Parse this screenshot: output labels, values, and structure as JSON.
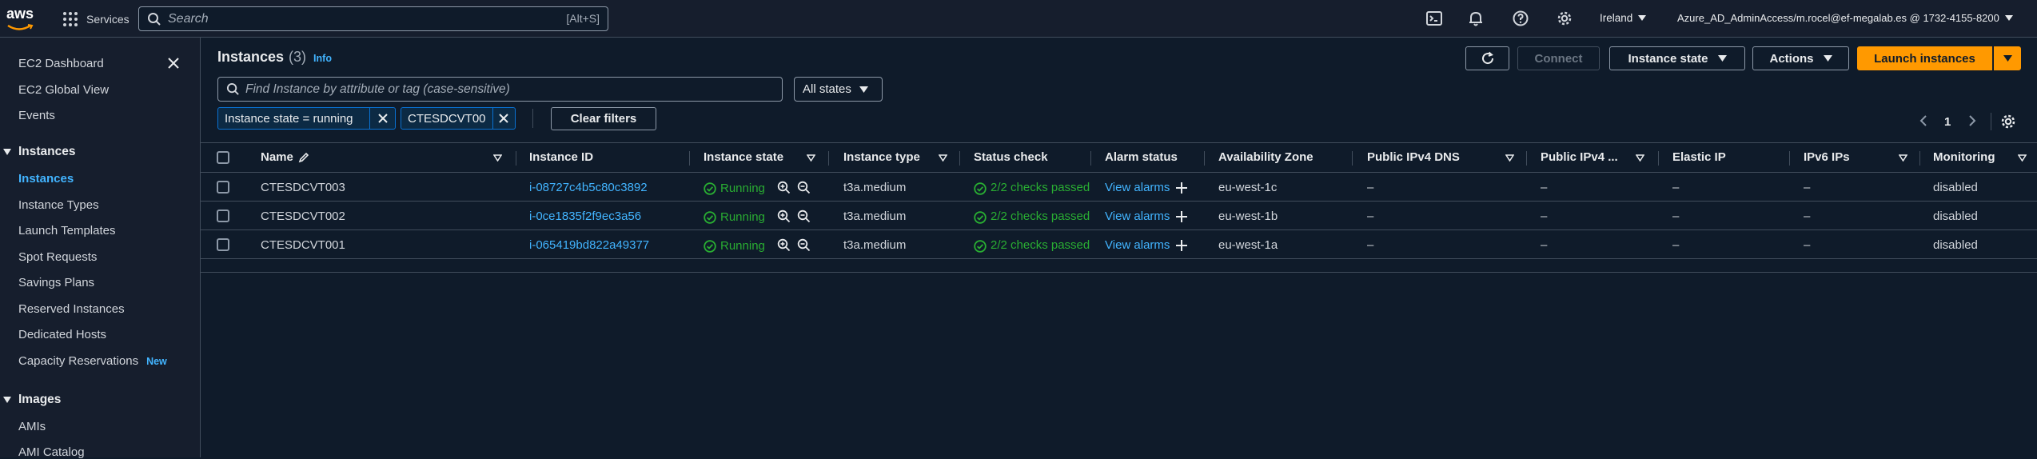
{
  "topnav": {
    "logo": "aws",
    "services_label": "Services",
    "search_placeholder": "Search",
    "search_shortcut": "[Alt+S]",
    "region": "Ireland",
    "account": "Azure_AD_AdminAccess/m.rocel@ef-megalab.es @ 1732-4155-8200"
  },
  "sidebar": {
    "items": [
      {
        "label": "EC2 Dashboard"
      },
      {
        "label": "EC2 Global View"
      },
      {
        "label": "Events"
      }
    ],
    "instances_section": "Instances",
    "instances_items": [
      {
        "label": "Instances"
      },
      {
        "label": "Instance Types"
      },
      {
        "label": "Launch Templates"
      },
      {
        "label": "Spot Requests"
      },
      {
        "label": "Savings Plans"
      },
      {
        "label": "Reserved Instances"
      },
      {
        "label": "Dedicated Hosts"
      },
      {
        "label": "Capacity Reservations"
      }
    ],
    "new_badge": "New",
    "images_section": "Images",
    "images_items": [
      {
        "label": "AMIs"
      },
      {
        "label": "AMI Catalog"
      }
    ]
  },
  "header": {
    "title": "Instances",
    "count": "(3)",
    "info": "Info",
    "connect": "Connect",
    "instance_state": "Instance state",
    "actions": "Actions",
    "launch": "Launch instances"
  },
  "filter": {
    "placeholder": "Find Instance by attribute or tag (case-sensitive)",
    "states_select": "All states",
    "chips": [
      "Instance state = running",
      "CTESDCVT00"
    ],
    "clear": "Clear filters",
    "page": "1"
  },
  "table": {
    "columns": [
      "Name",
      "Instance ID",
      "Instance state",
      "Instance type",
      "Status check",
      "Alarm status",
      "Availability Zone",
      "Public IPv4 DNS",
      "Public IPv4 ...",
      "Elastic IP",
      "IPv6 IPs",
      "Monitoring"
    ],
    "rows": [
      {
        "name": "CTESDCVT003",
        "id": "i-08727c4b5c80c3892",
        "state": "Running",
        "type": "t3a.medium",
        "status": "2/2 checks passed",
        "alarm": "View alarms",
        "az": "eu-west-1c",
        "dns": "–",
        "ipv4": "–",
        "eip": "–",
        "ipv6": "–",
        "monitoring": "disabled"
      },
      {
        "name": "CTESDCVT002",
        "id": "i-0ce1835f2f9ec3a56",
        "state": "Running",
        "type": "t3a.medium",
        "status": "2/2 checks passed",
        "alarm": "View alarms",
        "az": "eu-west-1b",
        "dns": "–",
        "ipv4": "–",
        "eip": "–",
        "ipv6": "–",
        "monitoring": "disabled"
      },
      {
        "name": "CTESDCVT001",
        "id": "i-065419bd822a49377",
        "state": "Running",
        "type": "t3a.medium",
        "status": "2/2 checks passed",
        "alarm": "View alarms",
        "az": "eu-west-1a",
        "dns": "–",
        "ipv4": "–",
        "eip": "–",
        "ipv6": "–",
        "monitoring": "disabled"
      }
    ]
  },
  "colors": {
    "background": "#0f1b2a",
    "nav": "#161e2d",
    "link": "#42b4ff",
    "accent": "#ff9900",
    "success": "#29ad32"
  }
}
